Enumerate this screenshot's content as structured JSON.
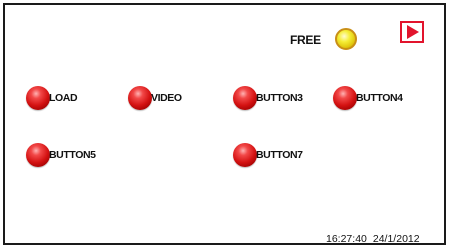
{
  "status": {
    "free_label": "FREE",
    "free_icon": "yellow-led",
    "free_color": "#f2e830"
  },
  "play": {
    "icon": "play-triangle",
    "color": "#e2142d"
  },
  "buttons": [
    {
      "label": "LOAD"
    },
    {
      "label": "VIDEO"
    },
    {
      "label": "BUTTON3"
    },
    {
      "label": "BUTTON4"
    },
    {
      "label": "BUTTON5"
    },
    {
      "label": "BUTTON7"
    }
  ],
  "button_color": "#d41212",
  "footer": {
    "time": "16:27:40",
    "date": "24/1/2012"
  }
}
